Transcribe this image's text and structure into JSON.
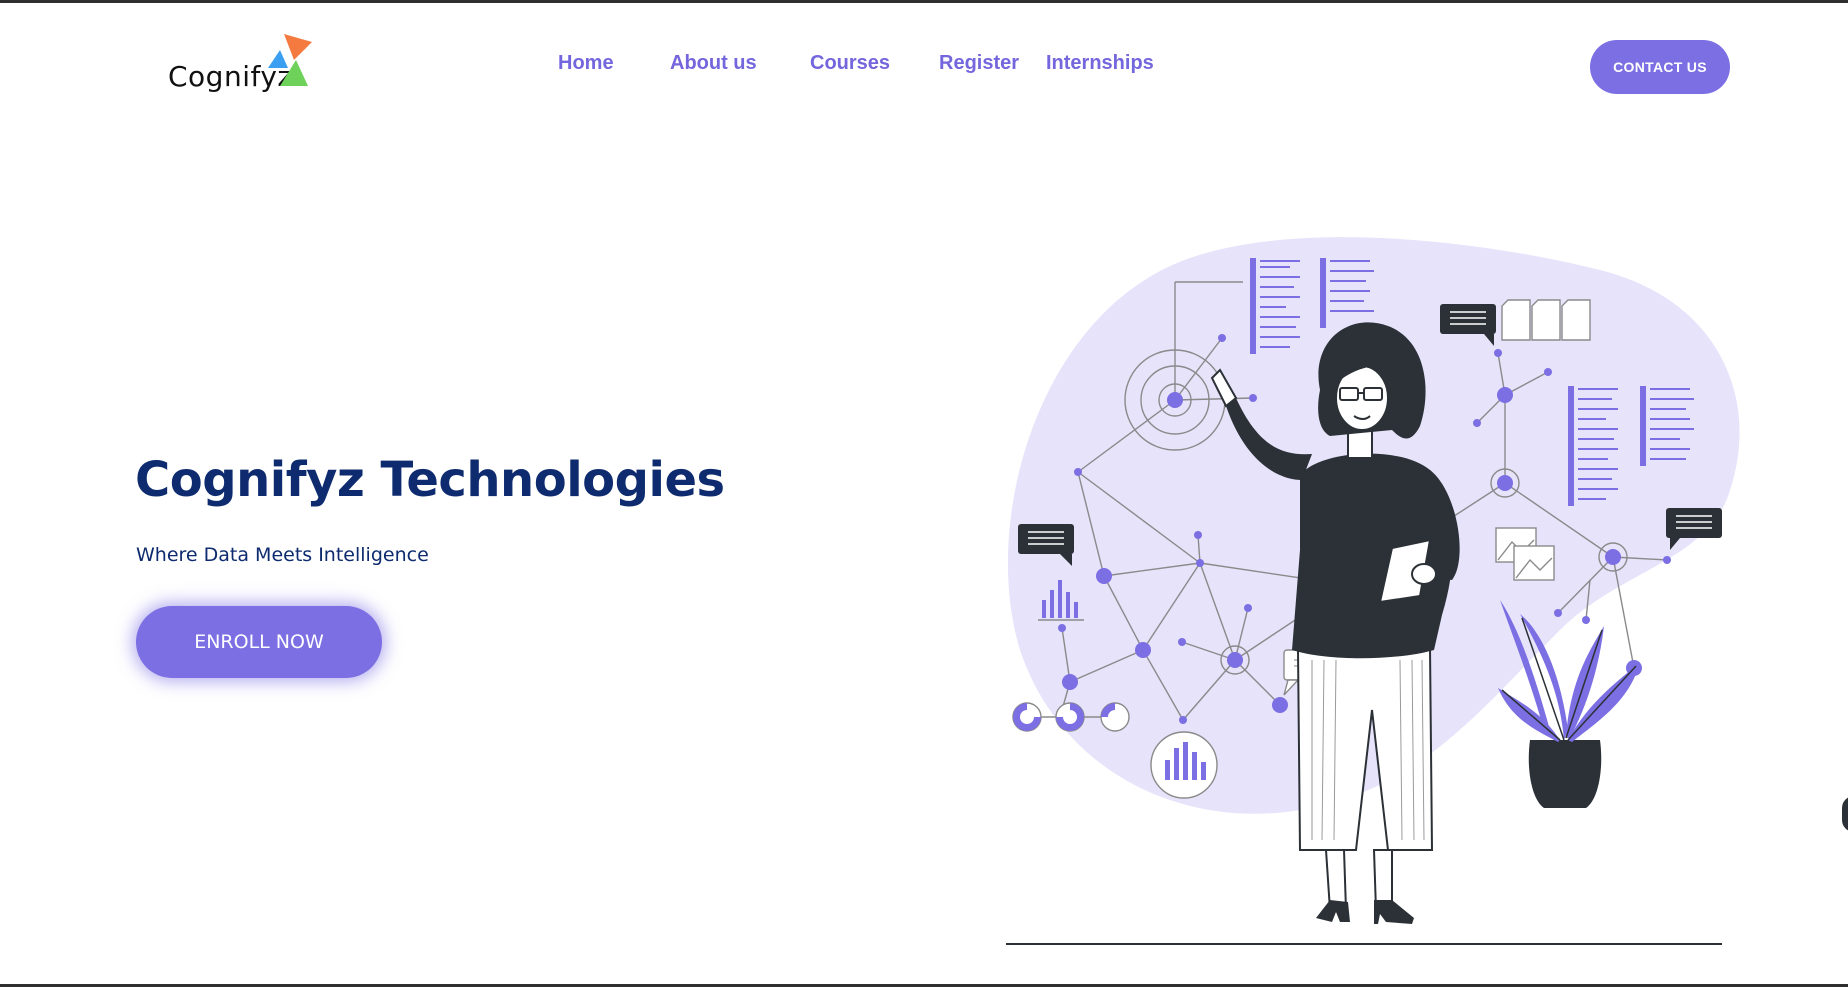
{
  "brand": {
    "name": "Cognifyz"
  },
  "nav": {
    "items": [
      {
        "label": "Home"
      },
      {
        "label": "About us"
      },
      {
        "label": "Courses"
      },
      {
        "label": "Register"
      },
      {
        "label": "Internships"
      }
    ],
    "contact_label": "CONTACT US"
  },
  "hero": {
    "title": "Cognifyz Technologies",
    "subtitle": "Where Data Meets Intelligence",
    "cta_label": "ENROLL NOW"
  },
  "colors": {
    "accent": "#7b6fe3",
    "nav_text": "#7466dc",
    "heading": "#0d2b6e",
    "blob": "#e6e3fb",
    "dark": "#2b3136",
    "logo_orange": "#f47a3f",
    "logo_blue": "#3a9ff0",
    "logo_green": "#6ed25a"
  },
  "icons": [
    "cognifyz-logo-triangles",
    "data-network-illustration",
    "chat-bubble-icon",
    "bar-chart-icon",
    "document-icon",
    "image-icon",
    "plant-illustration"
  ]
}
